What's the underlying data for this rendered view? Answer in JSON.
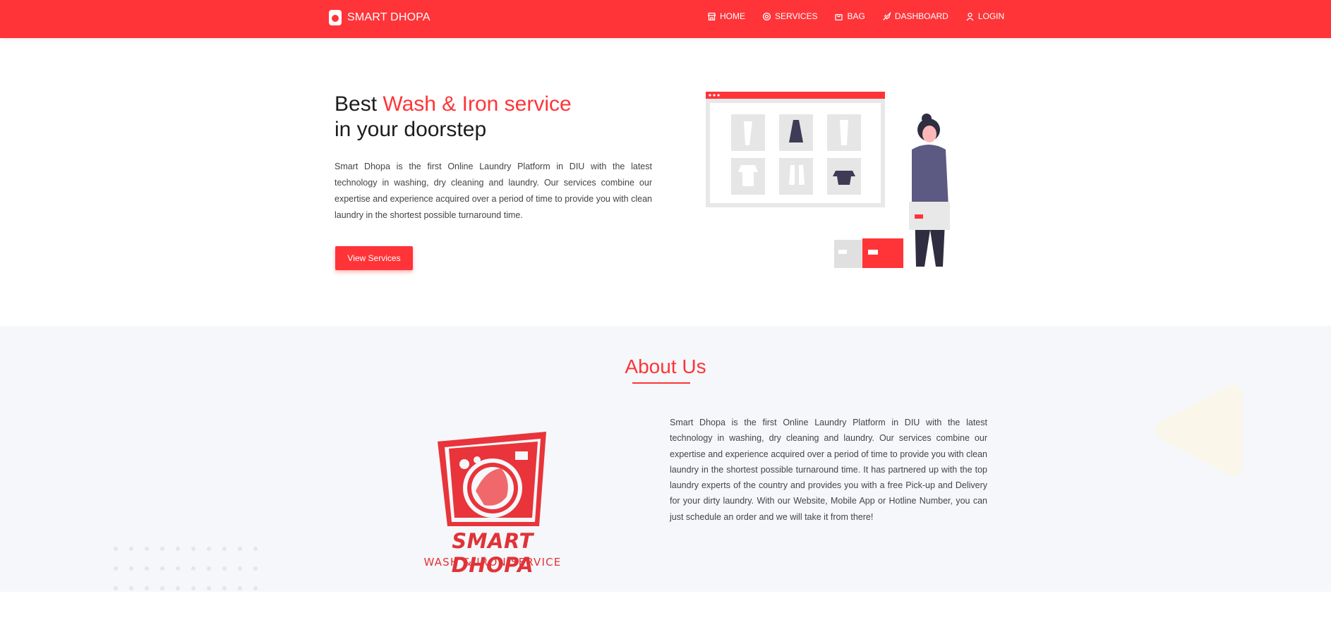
{
  "colors": {
    "brand": "#ff3438",
    "about_bg": "#f5f7fa",
    "text": "#444444"
  },
  "navbar": {
    "brand_name": "SMART DHOPA",
    "brand_icon": "washing-machine-icon",
    "items": [
      {
        "label": "HOME",
        "icon": "store-icon"
      },
      {
        "label": "SERVICES",
        "icon": "gear-icon"
      },
      {
        "label": "BAG",
        "icon": "bag-icon"
      },
      {
        "label": "DASHBOARD",
        "icon": "rocket-icon"
      },
      {
        "label": "LOGIN",
        "icon": "user-icon"
      }
    ]
  },
  "hero": {
    "title_prefix": "Best ",
    "title_accent": "Wash & Iron service",
    "title_line2": "in your doorstep",
    "description": "Smart Dhopa is the first Online Laundry Platform in DIU with the latest technology in washing, dry cleaning and laundry. Our services combine our expertise and experience acquired over a period of time to provide you with clean laundry in the shortest possible turnaround time.",
    "button_label": "View Services"
  },
  "about": {
    "title": "About Us",
    "description": "Smart Dhopa is the first Online Laundry Platform in DIU with the latest technology in washing, dry cleaning and laundry. Our services combine our expertise and experience acquired over a period of time to provide you with clean laundry in the shortest possible turnaround time. It has partnered up with the top laundry experts of the country and provides you with a free Pick-up and Delivery for your dirty laundry. With our Website, Mobile App or Hotline Number, you can just schedule an order and we will take it from there!",
    "logo_name": "SMART DHOPA",
    "logo_tagline": "WASH & IRON SERVICE"
  }
}
